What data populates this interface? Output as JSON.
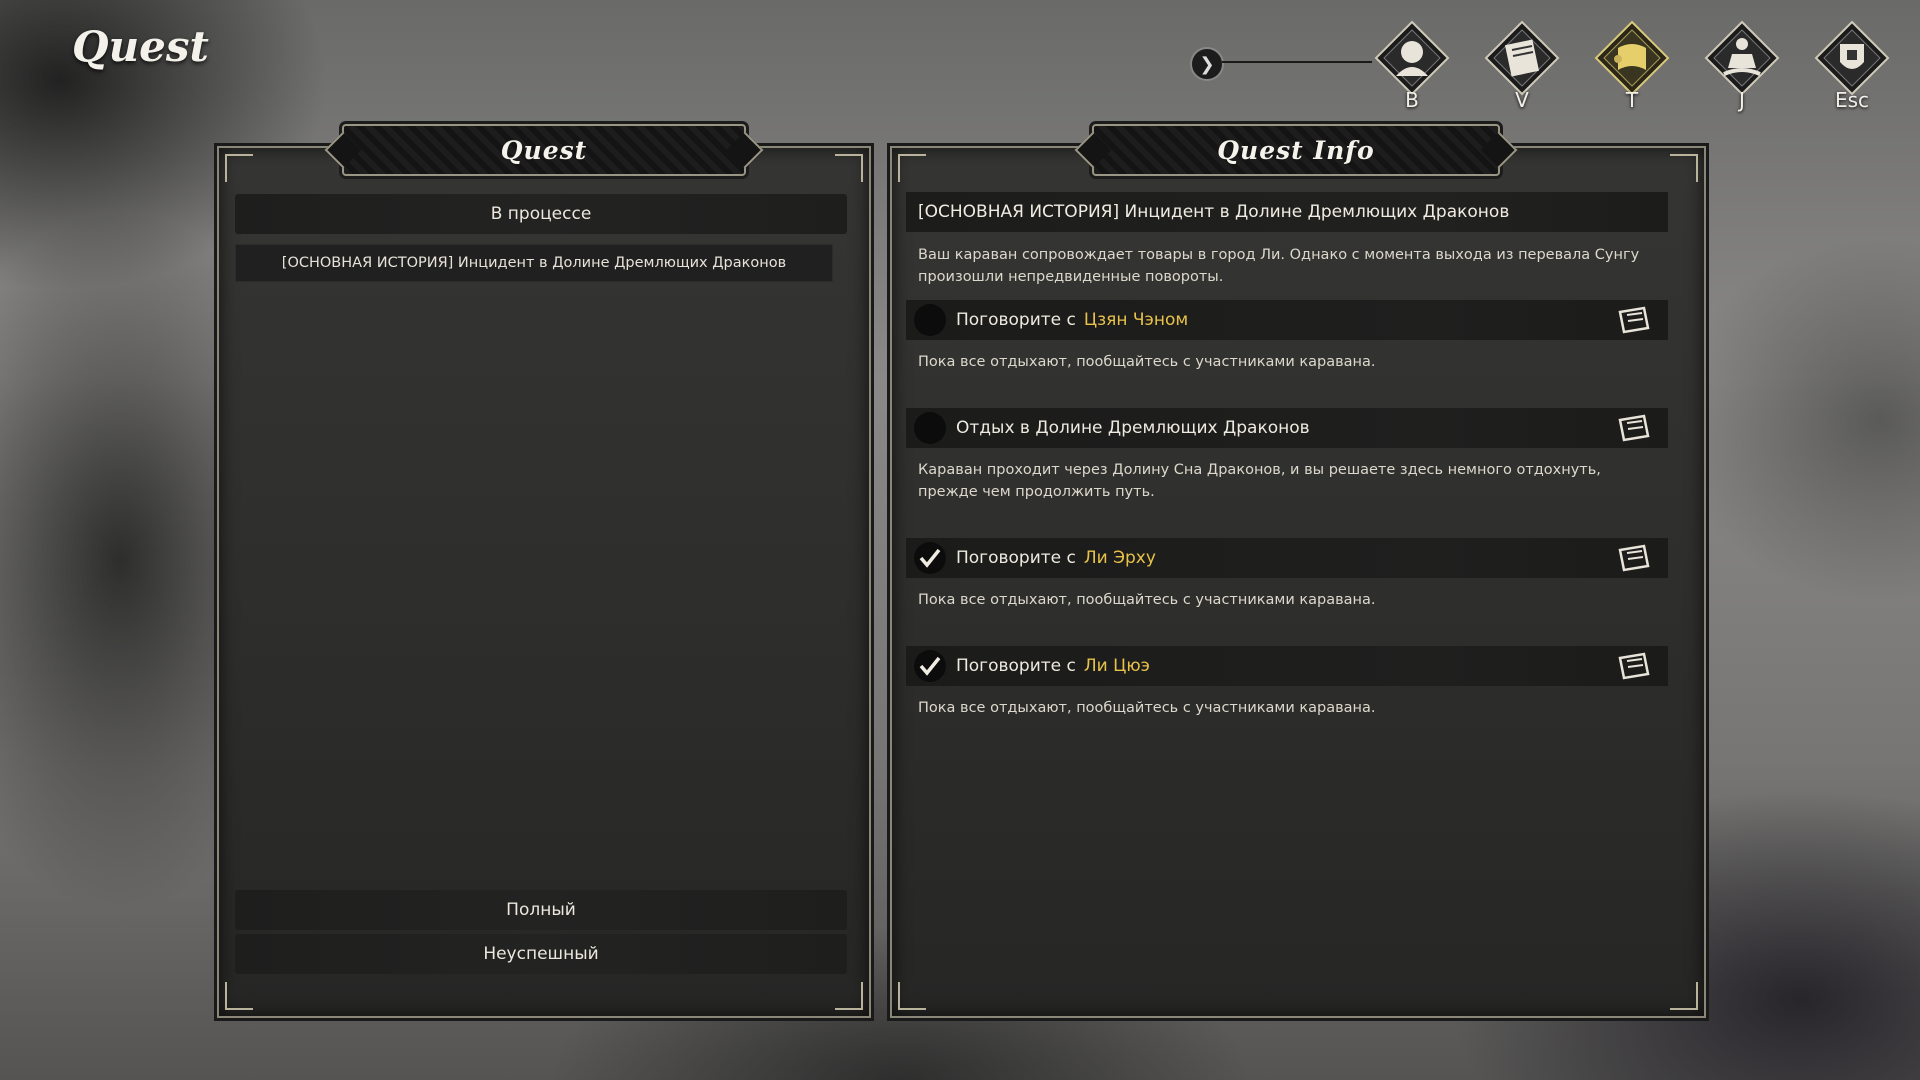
{
  "screen_title": "Quest",
  "top_nav": {
    "items": [
      {
        "icon": "character-portrait-icon",
        "key": "B"
      },
      {
        "icon": "book-icon",
        "key": "V"
      },
      {
        "icon": "scroll-quest-icon",
        "key": "T",
        "active": true
      },
      {
        "icon": "meditation-figure-icon",
        "key": "J"
      },
      {
        "icon": "shield-helmet-icon",
        "key": "Esc"
      }
    ]
  },
  "left_panel": {
    "header": "Quest",
    "categories": {
      "in_progress": "В процессе",
      "completed": "Полный",
      "failed": "Неуспешный"
    },
    "quests": [
      {
        "title": "[ОСНОВНАЯ ИСТОРИЯ] Инцидент в Долине Дремлющих Драконов"
      }
    ]
  },
  "right_panel": {
    "header": "Quest Info",
    "quest_title": "[ОСНОВНАЯ ИСТОРИЯ] Инцидент в Долине Дремлющих Драконов",
    "description": "Ваш караван сопровождает товары в город Ли. Однако с момента выхода из перевала Сунгу произошли непредвиденные повороты.",
    "tasks": [
      {
        "text": "Поговорите с",
        "npc": "Цзян Чэном",
        "done": false,
        "desc": "Пока все отдыхают, пообщайтесь с участниками каравана."
      },
      {
        "text": "Отдых в Долине Дремлющих Драконов",
        "npc": "",
        "done": false,
        "desc": "Караван проходит через Долину Сна Драконов, и вы решаете здесь немного отдохнуть, прежде чем продолжить путь."
      },
      {
        "text": "Поговорите с",
        "npc": "Ли Эрху",
        "done": true,
        "desc": "Пока все отдыхают, пообщайтесь с участниками каравана."
      },
      {
        "text": "Поговорите с",
        "npc": "Ли Цюэ",
        "done": true,
        "desc": "Пока все отдыхают, пообщайтесь с участниками каравана."
      }
    ]
  },
  "colors": {
    "npc_highlight": "#e8c24a",
    "active_nav": "#c9b25a"
  }
}
